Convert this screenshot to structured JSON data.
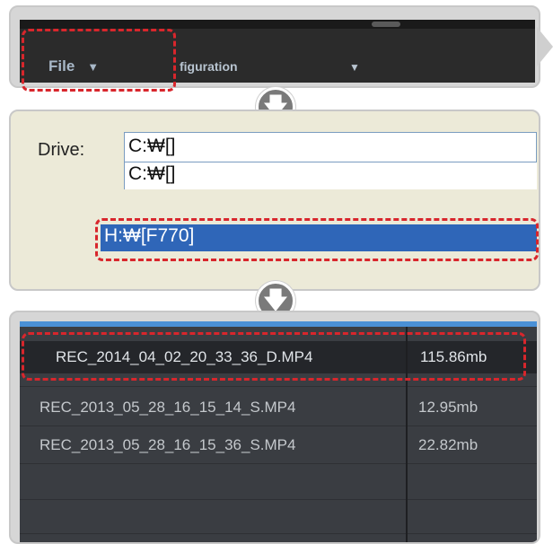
{
  "menu": {
    "file_label": "File",
    "file_arrow": "▼",
    "config_label": "figuration",
    "config_arrow": "▼"
  },
  "step_arrows": {
    "glyph": "🡇"
  },
  "drive": {
    "label": "Drive:",
    "current_value": "C:₩[]",
    "options": [
      {
        "label": "C:₩[]"
      },
      {
        "label": "H:₩[F770]",
        "selected": true
      }
    ]
  },
  "files": {
    "rows": [
      {
        "name": "REC_2014_04_02_20_33_36_D.MP4",
        "size": "115.86mb",
        "selected": true
      },
      {
        "name": "REC_2013_05_28_16_15_14_S.MP4",
        "size": "12.95mb"
      },
      {
        "name": "REC_2013_05_28_16_15_36_S.MP4",
        "size": "22.82mb"
      }
    ]
  },
  "colors": {
    "highlight": "#d8262c",
    "selected_drive": "#2f66b8",
    "list_background": "#3a3d42"
  }
}
